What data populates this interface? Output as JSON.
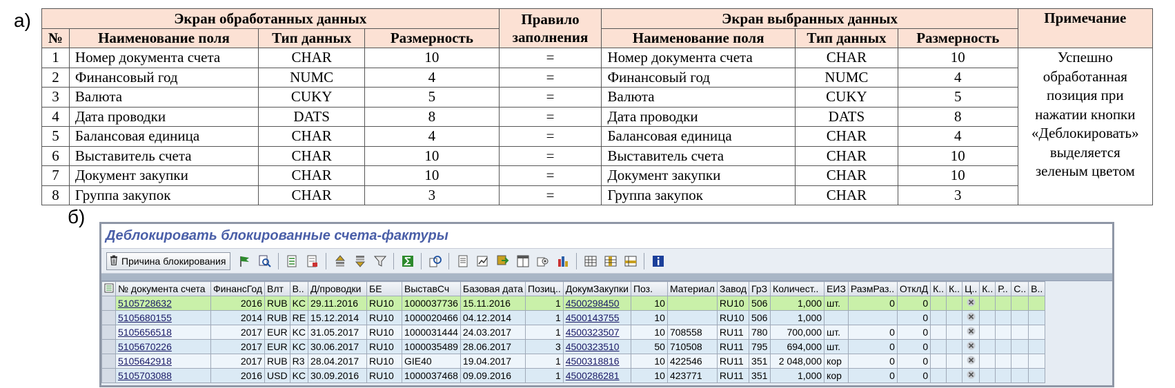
{
  "labels": {
    "a": "а)",
    "b": "б)"
  },
  "spec_table": {
    "group_left": "Экран обработанных данных",
    "rule_header": "Правило заполнения",
    "group_right": "Экран выбранных данных",
    "note_header": "Примечание",
    "col_num": "№",
    "col_field": "Наименование поля",
    "col_type": "Тип данных",
    "col_size": "Размерность",
    "col_field_r": "Наименование поля",
    "col_type_r": "Тип данных",
    "col_size_r": "Размерность",
    "rows": [
      {
        "n": "1",
        "field": "Номер документа счета",
        "type": "CHAR",
        "size": "10",
        "rule": "=",
        "field_r": "Номер документа счета",
        "type_r": "CHAR",
        "size_r": "10"
      },
      {
        "n": "2",
        "field": "Финансовый год",
        "type": "NUMC",
        "size": "4",
        "rule": "=",
        "field_r": "Финансовый год",
        "type_r": "NUMC",
        "size_r": "4"
      },
      {
        "n": "3",
        "field": "Валюта",
        "type": "CUKY",
        "size": "5",
        "rule": "=",
        "field_r": "Валюта",
        "type_r": "CUKY",
        "size_r": "5"
      },
      {
        "n": "4",
        "field": "Дата проводки",
        "type": "DATS",
        "size": "8",
        "rule": "=",
        "field_r": "Дата проводки",
        "type_r": "DATS",
        "size_r": "8"
      },
      {
        "n": "5",
        "field": "Балансовая единица",
        "type": "CHAR",
        "size": "4",
        "rule": "=",
        "field_r": "Балансовая единица",
        "type_r": "CHAR",
        "size_r": "4"
      },
      {
        "n": "6",
        "field": "Выставитель счета",
        "type": "CHAR",
        "size": "10",
        "rule": "=",
        "field_r": "Выставитель счета",
        "type_r": "CHAR",
        "size_r": "10"
      },
      {
        "n": "7",
        "field": "Документ закупки",
        "type": "CHAR",
        "size": "10",
        "rule": "=",
        "field_r": "Документ закупки",
        "type_r": "CHAR",
        "size_r": "10"
      },
      {
        "n": "8",
        "field": "Группа закупок",
        "type": "CHAR",
        "size": "3",
        "rule": "=",
        "field_r": "Группа закупок",
        "type_r": "CHAR",
        "size_r": "3"
      }
    ],
    "note_lines": [
      "Успешно",
      "обработанная",
      "позиция при",
      "нажатии кнопки",
      "«Деблокировать»",
      "выделяется",
      "зеленым цветом"
    ]
  },
  "sap": {
    "title": "Деблокировать блокированные счета-фактуры",
    "toolbar": {
      "reason_button": "Причина блокирования"
    },
    "columns": [
      "№ документа счета",
      "ФинансГод",
      "Влт",
      "В..",
      "Д/проводки",
      "БЕ",
      "ВыставСч",
      "Базовая дата",
      "Позиц..",
      "ДокумЗакупки",
      "Поз.",
      "Материал",
      "Завод",
      "ГрЗ",
      "Количест..",
      "ЕИЗ",
      "РазмРаз..",
      "ОтклД",
      "К..",
      "К..",
      "Ц..",
      "К..",
      "Р..",
      "С..",
      "В.."
    ],
    "rows": [
      {
        "doc": "5105728632",
        "year": "2016",
        "cur": "RUB",
        "v": "KC",
        "date": "29.11.2016",
        "be": "RU10",
        "vendor": "1000037736",
        "base": "15.11.2016",
        "pos": "1",
        "po": "4500298450",
        "item": "10",
        "mat": "",
        "plant": "RU10",
        "grp": "506",
        "qty": "1,000",
        "uom": "шт.",
        "razm": "0",
        "otkl": "0"
      },
      {
        "doc": "5105680155",
        "year": "2014",
        "cur": "RUB",
        "v": "RE",
        "date": "15.12.2014",
        "be": "RU10",
        "vendor": "1000020466",
        "base": "04.12.2014",
        "pos": "1",
        "po": "4500143755",
        "item": "10",
        "mat": "",
        "plant": "RU10",
        "grp": "506",
        "qty": "1,000",
        "uom": "",
        "razm": "",
        "otkl": "0"
      },
      {
        "doc": "5105656518",
        "year": "2017",
        "cur": "EUR",
        "v": "KC",
        "date": "31.05.2017",
        "be": "RU10",
        "vendor": "1000031444",
        "base": "24.03.2017",
        "pos": "1",
        "po": "4500323507",
        "item": "10",
        "mat": "708558",
        "plant": "RU11",
        "grp": "780",
        "qty": "700,000",
        "uom": "шт.",
        "razm": "0",
        "otkl": "0"
      },
      {
        "doc": "5105670226",
        "year": "2017",
        "cur": "EUR",
        "v": "KC",
        "date": "30.06.2017",
        "be": "RU10",
        "vendor": "1000035489",
        "base": "28.06.2017",
        "pos": "3",
        "po": "4500323510",
        "item": "50",
        "mat": "710508",
        "plant": "RU11",
        "grp": "795",
        "qty": "694,000",
        "uom": "шт.",
        "razm": "0",
        "otkl": "0"
      },
      {
        "doc": "5105642918",
        "year": "2017",
        "cur": "RUB",
        "v": "R3",
        "date": "28.04.2017",
        "be": "RU10",
        "vendor": "GIE40",
        "base": "19.04.2017",
        "pos": "1",
        "po": "4500318816",
        "item": "10",
        "mat": "422546",
        "plant": "RU11",
        "grp": "351",
        "qty": "2 048,000",
        "uom": "кор",
        "razm": "0",
        "otkl": "0"
      },
      {
        "doc": "5105703088",
        "year": "2016",
        "cur": "USD",
        "v": "KC",
        "date": "30.09.2016",
        "be": "RU10",
        "vendor": "1000037468",
        "base": "09.09.2016",
        "pos": "1",
        "po": "4500286281",
        "item": "10",
        "mat": "423771",
        "plant": "RU11",
        "grp": "351",
        "qty": "1,000",
        "uom": "кор",
        "razm": "0",
        "otkl": "0"
      }
    ],
    "colors": {
      "success_row": "#c9f0a9",
      "row_alt": "#dbeaf5",
      "title_text": "#4a5fa8"
    }
  }
}
